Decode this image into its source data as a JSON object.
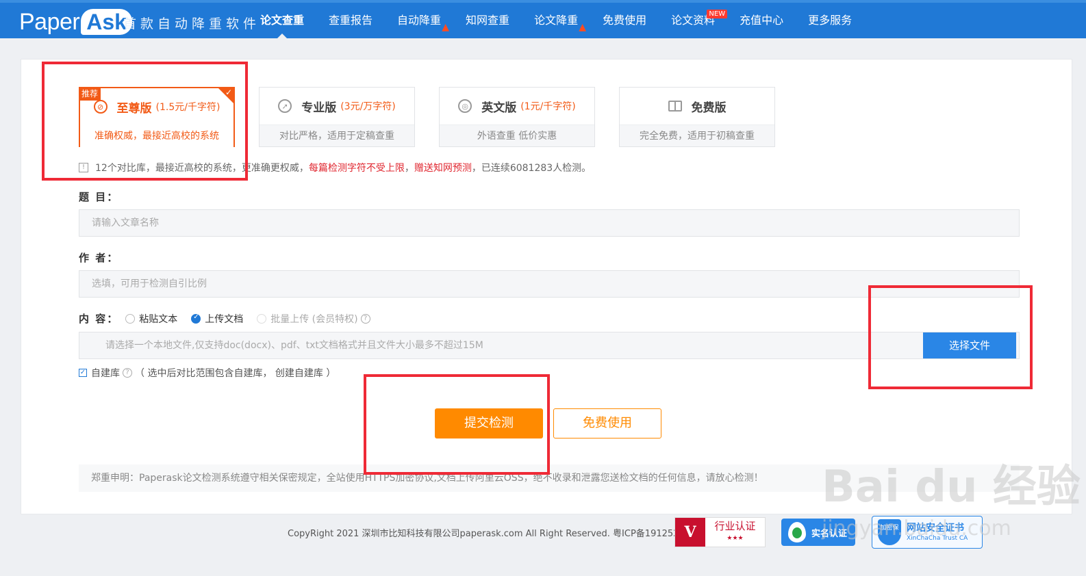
{
  "header": {
    "logo_paper": "Paper",
    "logo_ask": "Ask",
    "slogan": "首款自动降重软件",
    "nav": [
      {
        "label": "论文查重",
        "active": true
      },
      {
        "label": "查重报告"
      },
      {
        "label": "自动降重",
        "hot": true
      },
      {
        "label": "知网查重"
      },
      {
        "label": "论文降重",
        "hot": true
      },
      {
        "label": "免费使用"
      },
      {
        "label": "论文资料",
        "new": true
      },
      {
        "label": "充值中心"
      },
      {
        "label": "更多服务"
      }
    ],
    "new_badge": "NEW",
    "color": "#2079d6"
  },
  "plans": [
    {
      "tag": "推荐",
      "name": "至尊版",
      "price": "(1.5元/千字符)",
      "desc": "准确权威，最接近高校的系统",
      "selected": true,
      "icon": "no-copy-icon"
    },
    {
      "name": "专业版",
      "price": "(3元/万字符)",
      "desc": "对比严格，适用于定稿查重",
      "icon": "compass-icon"
    },
    {
      "name": "英文版",
      "price": "(1元/千字符)",
      "desc": "外语查重 低价实惠",
      "icon": "target-icon"
    },
    {
      "name": "免费版",
      "price": "",
      "desc": "完全免费，适用于初稿查重",
      "icon": "book-icon"
    }
  ],
  "notice": {
    "text1": "12个对比库，最接近高校的系统，更准确更权威，",
    "red1": "每篇检测字符不受上限",
    "sep": "，",
    "red2": "赠送知网预测",
    "text2": "，已连续6081283人检测。"
  },
  "form": {
    "title_label": "题 目：",
    "title_placeholder": "请输入文章名称",
    "author_label": "作 者：",
    "author_placeholder": "选填，可用于检测自引比例",
    "content_label": "内 容：",
    "radio_paste": "粘贴文本",
    "radio_upload": "上传文档",
    "radio_batch": "批量上传 (会员特权)",
    "file_hint": "请选择一个本地文件,仅支持doc(docx)、pdf、txt文档格式并且文件大小最多不超过15M",
    "file_button": "选择文件",
    "selfdb_label": "自建库",
    "selfdb_note": "（ 选中后对比范围包含自建库，  创建自建库 ）",
    "submit": "提交检测",
    "free": "免费使用"
  },
  "disclaimer": "郑重申明：Paperask论文检测系统遵守相关保密规定，全站使用HTTPS加密协议,文档上传阿里云OSS，绝不收录和泄露您送检文档的任何信息，请放心检测！",
  "footer": {
    "copyright": "CopyRight 2021 深圳市比知科技有限公司paperask.com All Right Reserved. 粤ICP备19125200号-1",
    "cert1_v": "V",
    "cert1_text": "行业认证",
    "cert1_stars": "★★★",
    "cert2_text": "实名认证",
    "cert3_shield": "加密保",
    "cert3_t1": "网站安全证书",
    "cert3_t2": "XinChaCha Trust CA"
  },
  "watermark": {
    "main": "Bai du 经验",
    "sub": "jingyan.baidu.com"
  },
  "accent": "#f25a16",
  "submit_color": "#ff8a00",
  "annotation_color": "#ef2a36"
}
